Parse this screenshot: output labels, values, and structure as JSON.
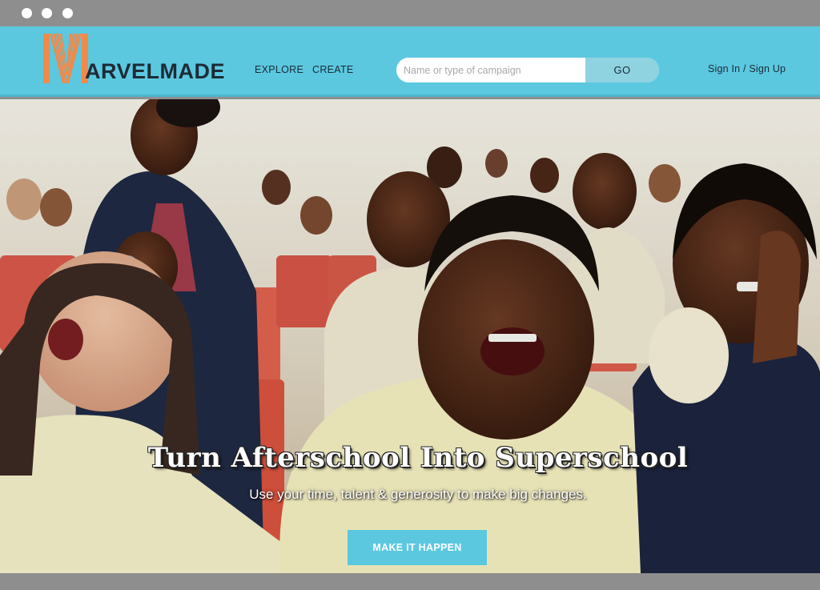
{
  "window": {
    "chrome": "browser-mockup",
    "dots": 3
  },
  "colors": {
    "accent": "#5bc8e0",
    "search_button": "#8fd3e1",
    "text_dark": "#1b2a35",
    "logo_orange": "#f08a4b"
  },
  "header": {
    "logo_text": "ARVELMADE",
    "nav": {
      "explore": "EXPLORE",
      "create": "CREATE"
    },
    "search": {
      "placeholder": "Name or type of campaign",
      "value": "",
      "button_label": "GO"
    },
    "auth_link": "Sign In / Sign Up"
  },
  "hero": {
    "headline": "Turn Afterschool Into Superschool",
    "subheadline": "Use your time, talent & generosity to make big changes.",
    "cta_label": "MAKE IT HAPPEN",
    "image": "photo-of-laughing-schoolchildren-in-auditorium"
  }
}
